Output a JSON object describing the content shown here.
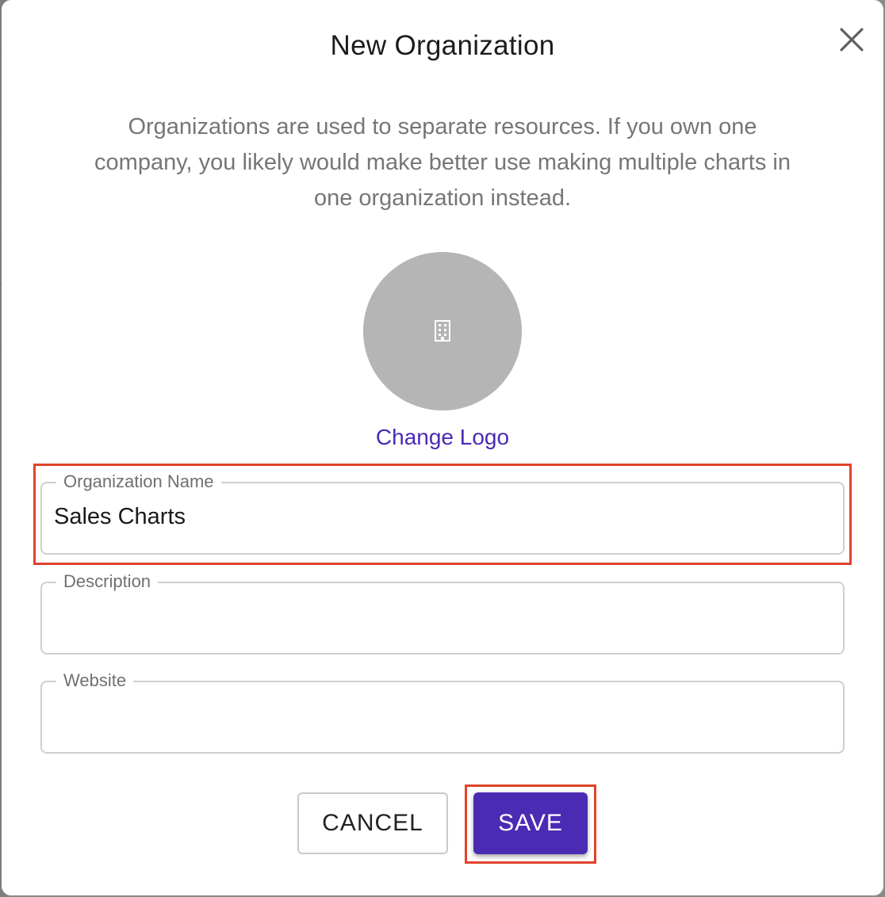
{
  "dialog": {
    "title": "New Organization",
    "description": "Organizations are used to separate resources. If you own one company, you likely would make better use making multiple charts in one organization instead.",
    "change_logo_label": "Change Logo",
    "logo_icon": "building-icon",
    "close_icon": "close-icon"
  },
  "form": {
    "organization_name": {
      "label": "Organization Name",
      "value": "Sales Charts"
    },
    "description": {
      "label": "Description",
      "value": ""
    },
    "website": {
      "label": "Website",
      "value": ""
    }
  },
  "actions": {
    "cancel_label": "CANCEL",
    "save_label": "SAVE"
  },
  "colors": {
    "accent": "#4a2bb3",
    "highlight": "#e0432a",
    "logo_placeholder": "#b5b5b5"
  }
}
